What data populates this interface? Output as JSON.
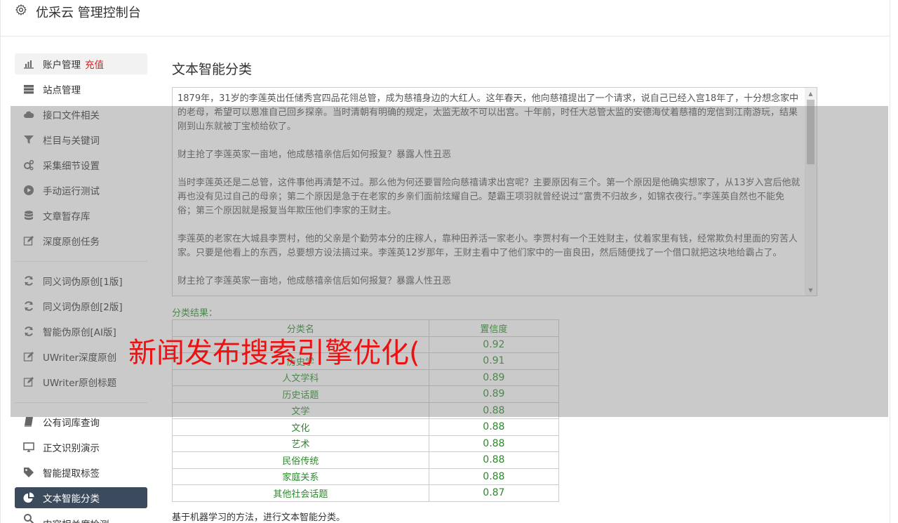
{
  "header": {
    "title": "优采云 管理控制台",
    "icon": "gear-icon"
  },
  "sidebar": {
    "items": [
      {
        "label": "账户管理",
        "badge": "充值",
        "icon": "bar-chart-icon"
      },
      {
        "label": "站点管理",
        "icon": "server-icon"
      },
      {
        "label": "接口文件相关",
        "icon": "cloud-upload-icon"
      },
      {
        "label": "栏目与关键词",
        "icon": "filter-icon"
      },
      {
        "label": "采集细节设置",
        "icon": "cogs-icon"
      },
      {
        "label": "手动运行测试",
        "icon": "play-circle-icon"
      },
      {
        "label": "文章暂存库",
        "icon": "database-icon"
      },
      {
        "label": "深度原创任务",
        "icon": "edit-icon"
      },
      {
        "label": "同义词伪原创[1版]",
        "icon": "refresh-icon"
      },
      {
        "label": "同义词伪原创[2版]",
        "icon": "refresh-icon"
      },
      {
        "label": "智能伪原创[AI版]",
        "icon": "refresh-icon"
      },
      {
        "label": "UWriter深度原创",
        "icon": "edit-icon"
      },
      {
        "label": "UWriter原创标题",
        "icon": "edit-icon"
      },
      {
        "label": "公有词库查询",
        "icon": "book-icon"
      },
      {
        "label": "正文识别演示",
        "icon": "desktop-icon"
      },
      {
        "label": "智能提取标签",
        "icon": "tag-icon"
      },
      {
        "label": "文本智能分类",
        "icon": "pie-chart-icon"
      },
      {
        "label": "内容相关度检测",
        "icon": "search-icon"
      }
    ]
  },
  "main": {
    "title": "文本智能分类",
    "textarea": {
      "paragraphs": [
        "1879年，31岁的李莲英出任储秀宫四品花翎总管，成为慈禧身边的大红人。这年春天，他向慈禧提出了一个请求，说自己已经入宫18年了，十分想念家中的老母，希望可以恩准自己回乡探亲。当时清朝有明确的规定，太监无故不可以出宫。十年前，时任大总管太监的安德海仗着慈禧的宠信到江南游玩，结果刚到山东就被丁宝桢给砍了。",
        "财主抢了李莲英家一亩地，他成慈禧亲信后如何报复？暴露人性丑恶",
        "当时李莲英还是二总管，这件事他再清楚不过。那么他为何还要冒险向慈禧请求出宫呢？主要原因有三个。第一个原因是他确实想家了，从13岁入宫后他就再也没有见过自己的母亲；第二个原因是急于在老家的乡亲们面前炫耀自己。楚霸王项羽就曾经说过“富贵不归故乡，如锦衣夜行。”李莲英自然也不能免俗；第三个原因就是报复当年欺压他们李家的王财主。",
        "李莲英的老家在大城县李贾村，他的父亲是个勤劳本分的庄稼人，靠种田养活一家老小。李贾村有一个王姓财主，仗着家里有钱，经常欺负村里面的穷苦人家。只要是他看上的东西，总要想方设法搞过来。李莲英12岁那年，王财主看中了他们家中的一亩良田，然后随便找了一个借口就把这块地给霸占了。",
        "财主抢了李莲英家一亩地，他成慈禧亲信后如何报复？暴露人性丑恶"
      ]
    },
    "result_label": "分类结果：",
    "table": {
      "headers": [
        "分类名",
        "置信度"
      ],
      "rows": [
        [
          "",
          "0.92"
        ],
        [
          "历史学",
          "0.91"
        ],
        [
          "人文学科",
          "0.89"
        ],
        [
          "历史话题",
          "0.89"
        ],
        [
          "文学",
          "0.88"
        ],
        [
          "文化",
          "0.88"
        ],
        [
          "艺术",
          "0.88"
        ],
        [
          "民俗传统",
          "0.88"
        ],
        [
          "家庭关系",
          "0.88"
        ],
        [
          "其他社会话题",
          "0.87"
        ]
      ]
    },
    "footnote": "基于机器学习的方法，进行文本智能分类。"
  },
  "overlay": {
    "text": "新闻发布搜索引擎优化("
  },
  "colors": {
    "active_bg": "#3c4a5e",
    "accent_green": "#2a8a2a",
    "badge_red": "#e01919",
    "overlay_text": "#ee1111"
  }
}
